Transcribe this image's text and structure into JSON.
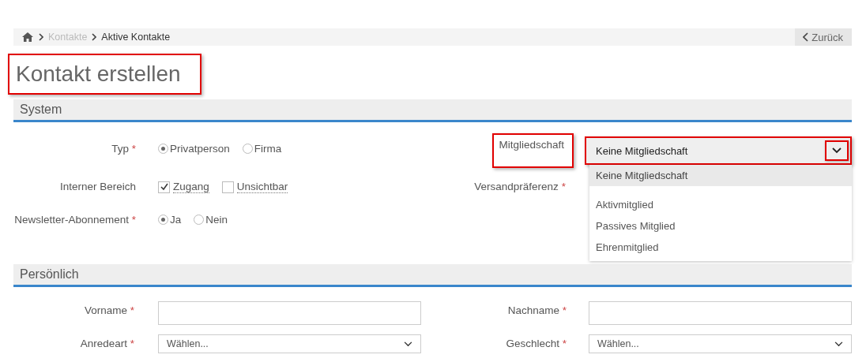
{
  "breadcrumb": {
    "items": [
      {
        "label": "Kontakte",
        "current": false
      },
      {
        "label": "Aktive Kontakte",
        "current": true
      }
    ]
  },
  "back_button": {
    "label": "Zurück"
  },
  "title": {
    "text": "Kontakt erstellen",
    "highlighted": true
  },
  "system": {
    "title": "System",
    "left_fields": [
      {
        "label": "Typ",
        "required_mark": "*",
        "kind": "radio",
        "options": [
          {
            "label": "Privatperson",
            "selected": true
          },
          {
            "label": "Firma",
            "selected": false
          }
        ]
      },
      {
        "label": "Interner Bereich",
        "kind": "checkbox",
        "options": [
          {
            "label": "Zugang",
            "checked": true
          },
          {
            "label": "Unsichtbar",
            "checked": false
          }
        ]
      },
      {
        "label": "Newsletter-Abonnement",
        "required_mark": "*",
        "kind": "radio",
        "options": [
          {
            "label": "Ja",
            "selected": true
          },
          {
            "label": "Nein",
            "selected": false
          }
        ]
      }
    ],
    "right_fields": [
      {
        "label": "Mitgliedschaft",
        "kind": "select",
        "label_highlighted": true,
        "value": "Keine Mitgliedschaft",
        "highlighted": true,
        "toggle_highlighted": true,
        "expanded": true,
        "options": [
          {
            "label": "Keine Mitgliedschaft",
            "selected": true
          },
          {
            "label": "Aktivmitglied",
            "selected": false
          },
          {
            "label": "Passives Mitglied",
            "selected": false
          },
          {
            "label": "Ehrenmitglied",
            "selected": false
          }
        ]
      },
      {
        "label": "Versandpräferenz",
        "required_mark": "*",
        "kind": "empty",
        "label_highlighted": false
      }
    ]
  },
  "personal": {
    "title": "Persönlich",
    "fields": [
      {
        "label": "Vorname",
        "required_mark": "*",
        "kind": "text"
      },
      {
        "label": "Nachname",
        "required_mark": "*",
        "kind": "text"
      },
      {
        "label": "Anredeart",
        "required_mark": "*",
        "kind": "select",
        "placeholder": "Wählen..."
      },
      {
        "label": "Geschlecht",
        "required_mark": "*",
        "kind": "select",
        "placeholder": "Wählen..."
      }
    ]
  }
}
